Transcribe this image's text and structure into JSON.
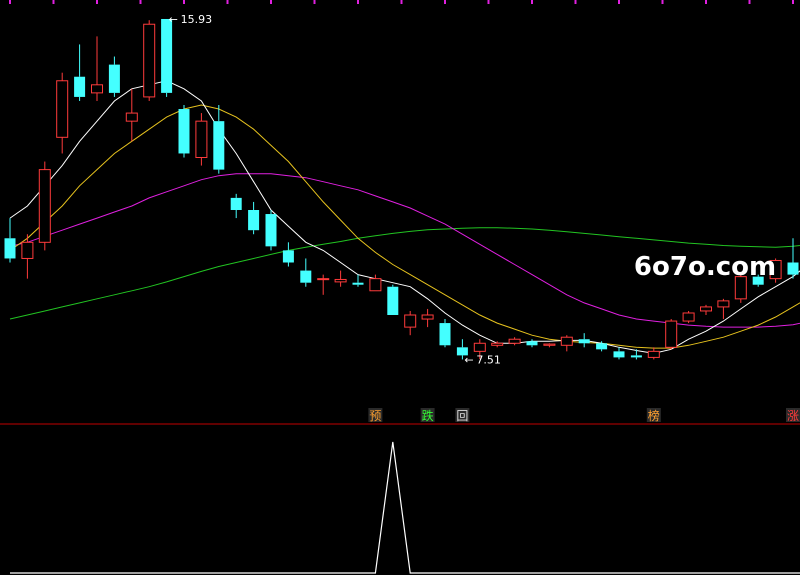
{
  "watermark": "6o7o.com",
  "colors": {
    "background": "#000000",
    "up": "#ff3b3b",
    "down": "#44ffff",
    "ma5": "#ffffff",
    "ma10": "#e6c21e",
    "ma30": "#e020e0",
    "ma60": "#22c422",
    "divider": "#c00000",
    "marker_bg": "#2a2a2a",
    "indicator": "#ffffff",
    "annotation": "#ffffff",
    "top_tick": "#e020e0"
  },
  "chart_data": [
    {
      "type": "candlestick",
      "high_label": "15.93",
      "low_label": "7.51",
      "high_arrow": "←",
      "low_arrow": "←",
      "ylim": [
        6.0,
        16.4
      ],
      "candles": [
        {
          "o": 10.5,
          "h": 11.0,
          "l": 9.9,
          "c": 10.0
        },
        {
          "o": 10.0,
          "h": 10.6,
          "l": 9.5,
          "c": 10.4
        },
        {
          "o": 10.4,
          "h": 12.4,
          "l": 10.2,
          "c": 12.2
        },
        {
          "o": 13.0,
          "h": 14.6,
          "l": 12.6,
          "c": 14.4
        },
        {
          "o": 14.5,
          "h": 15.3,
          "l": 13.9,
          "c": 14.0
        },
        {
          "o": 14.1,
          "h": 15.5,
          "l": 13.9,
          "c": 14.3
        },
        {
          "o": 14.8,
          "h": 15.0,
          "l": 14.0,
          "c": 14.1
        },
        {
          "o": 13.4,
          "h": 14.2,
          "l": 12.9,
          "c": 13.6
        },
        {
          "o": 14.0,
          "h": 15.9,
          "l": 13.9,
          "c": 15.8
        },
        {
          "o": 15.93,
          "h": 15.93,
          "l": 14.0,
          "c": 14.1
        },
        {
          "o": 13.7,
          "h": 13.8,
          "l": 12.5,
          "c": 12.6
        },
        {
          "o": 12.5,
          "h": 13.6,
          "l": 12.3,
          "c": 13.4
        },
        {
          "o": 13.4,
          "h": 13.8,
          "l": 12.1,
          "c": 12.2
        },
        {
          "o": 11.5,
          "h": 11.6,
          "l": 11.0,
          "c": 11.2
        },
        {
          "o": 11.2,
          "h": 11.4,
          "l": 10.6,
          "c": 10.7
        },
        {
          "o": 11.1,
          "h": 11.2,
          "l": 10.2,
          "c": 10.3
        },
        {
          "o": 10.2,
          "h": 10.4,
          "l": 9.8,
          "c": 9.9
        },
        {
          "o": 9.7,
          "h": 10.0,
          "l": 9.3,
          "c": 9.4
        },
        {
          "o": 9.5,
          "h": 9.6,
          "l": 9.1,
          "c": 9.5
        },
        {
          "o": 9.42,
          "h": 9.7,
          "l": 9.3,
          "c": 9.48
        },
        {
          "o": 9.4,
          "h": 9.6,
          "l": 9.3,
          "c": 9.35
        },
        {
          "o": 9.2,
          "h": 9.6,
          "l": 9.2,
          "c": 9.5
        },
        {
          "o": 9.3,
          "h": 9.35,
          "l": 8.6,
          "c": 8.6
        },
        {
          "o": 8.3,
          "h": 8.7,
          "l": 8.1,
          "c": 8.6
        },
        {
          "o": 8.5,
          "h": 8.75,
          "l": 8.3,
          "c": 8.6
        },
        {
          "o": 8.4,
          "h": 8.5,
          "l": 7.8,
          "c": 7.85
        },
        {
          "o": 7.8,
          "h": 8.0,
          "l": 7.5,
          "c": 7.6
        },
        {
          "o": 7.7,
          "h": 8.0,
          "l": 7.51,
          "c": 7.9
        },
        {
          "o": 7.85,
          "h": 7.95,
          "l": 7.8,
          "c": 7.9
        },
        {
          "o": 7.9,
          "h": 8.05,
          "l": 7.85,
          "c": 8.0
        },
        {
          "o": 7.95,
          "h": 8.0,
          "l": 7.8,
          "c": 7.85
        },
        {
          "o": 7.85,
          "h": 7.9,
          "l": 7.8,
          "c": 7.88
        },
        {
          "o": 7.85,
          "h": 8.1,
          "l": 7.7,
          "c": 8.05
        },
        {
          "o": 8.0,
          "h": 8.15,
          "l": 7.8,
          "c": 7.9
        },
        {
          "o": 7.9,
          "h": 7.95,
          "l": 7.7,
          "c": 7.75
        },
        {
          "o": 7.7,
          "h": 7.8,
          "l": 7.5,
          "c": 7.55
        },
        {
          "o": 7.6,
          "h": 7.75,
          "l": 7.5,
          "c": 7.55
        },
        {
          "o": 7.55,
          "h": 7.8,
          "l": 7.5,
          "c": 7.7
        },
        {
          "o": 7.8,
          "h": 8.5,
          "l": 7.75,
          "c": 8.45
        },
        {
          "o": 8.45,
          "h": 8.7,
          "l": 8.4,
          "c": 8.65
        },
        {
          "o": 8.7,
          "h": 8.85,
          "l": 8.6,
          "c": 8.8
        },
        {
          "o": 8.8,
          "h": 9.0,
          "l": 8.5,
          "c": 8.95
        },
        {
          "o": 9.0,
          "h": 9.6,
          "l": 8.9,
          "c": 9.55
        },
        {
          "o": 9.55,
          "h": 9.6,
          "l": 9.3,
          "c": 9.35
        },
        {
          "o": 9.5,
          "h": 10.0,
          "l": 9.4,
          "c": 9.95
        },
        {
          "o": 9.9,
          "h": 10.5,
          "l": 9.5,
          "c": 9.6
        },
        {
          "o": 9.6,
          "h": 10.6,
          "l": 9.55,
          "c": 10.5
        }
      ],
      "ma5": [
        11.0,
        11.3,
        11.8,
        12.3,
        12.9,
        13.4,
        13.9,
        14.2,
        14.3,
        14.4,
        14.2,
        13.9,
        13.2,
        12.6,
        11.9,
        11.2,
        10.8,
        10.4,
        10.2,
        9.9,
        9.6,
        9.5,
        9.4,
        9.3,
        9.0,
        8.65,
        8.35,
        8.1,
        7.9,
        7.9,
        7.95,
        7.95,
        7.97,
        7.97,
        7.9,
        7.8,
        7.72,
        7.65,
        7.75,
        8.0,
        8.2,
        8.45,
        8.75,
        9.05,
        9.3,
        9.55,
        9.9
      ],
      "ma10": [
        10.2,
        10.5,
        10.9,
        11.3,
        11.8,
        12.2,
        12.6,
        12.9,
        13.2,
        13.5,
        13.7,
        13.8,
        13.7,
        13.5,
        13.2,
        12.8,
        12.4,
        11.9,
        11.4,
        10.95,
        10.5,
        10.15,
        9.85,
        9.6,
        9.35,
        9.1,
        8.85,
        8.6,
        8.4,
        8.25,
        8.1,
        8.0,
        7.95,
        7.92,
        7.9,
        7.85,
        7.8,
        7.78,
        7.78,
        7.85,
        7.95,
        8.05,
        8.2,
        8.35,
        8.55,
        8.8,
        9.05
      ],
      "ma30": [
        10.3,
        10.4,
        10.55,
        10.7,
        10.85,
        11.0,
        11.15,
        11.3,
        11.5,
        11.65,
        11.8,
        11.95,
        12.05,
        12.1,
        12.1,
        12.1,
        12.05,
        12.0,
        11.9,
        11.8,
        11.7,
        11.55,
        11.4,
        11.25,
        11.05,
        10.85,
        10.6,
        10.35,
        10.1,
        9.85,
        9.6,
        9.35,
        9.1,
        8.9,
        8.75,
        8.6,
        8.5,
        8.45,
        8.4,
        8.35,
        8.32,
        8.3,
        8.3,
        8.3,
        8.32,
        8.36,
        8.45
      ],
      "ma60": [
        8.5,
        8.6,
        8.7,
        8.8,
        8.9,
        9.0,
        9.1,
        9.2,
        9.3,
        9.42,
        9.55,
        9.68,
        9.8,
        9.9,
        10.0,
        10.1,
        10.2,
        10.28,
        10.35,
        10.42,
        10.5,
        10.56,
        10.62,
        10.67,
        10.71,
        10.73,
        10.75,
        10.76,
        10.76,
        10.75,
        10.73,
        10.7,
        10.66,
        10.62,
        10.58,
        10.54,
        10.5,
        10.46,
        10.42,
        10.38,
        10.35,
        10.32,
        10.3,
        10.29,
        10.28,
        10.3,
        10.35
      ]
    },
    {
      "type": "line",
      "values": [
        0,
        0,
        0,
        0,
        0,
        0,
        0,
        0,
        0,
        0,
        0,
        0,
        0,
        0,
        0,
        0,
        0,
        0,
        0,
        0,
        0,
        0,
        1,
        0,
        0,
        0,
        0,
        0,
        0,
        0,
        0,
        0,
        0,
        0,
        0,
        0,
        0,
        0,
        0,
        0,
        0,
        0,
        0,
        0,
        0,
        0,
        0
      ],
      "ylim": [
        0,
        1
      ]
    }
  ],
  "signals": [
    {
      "index": 21,
      "label": "预",
      "color": "#ffa030"
    },
    {
      "index": 24,
      "label": "跌",
      "color": "#33ff33"
    },
    {
      "index": 26,
      "label": "回",
      "color": "#dddddd"
    },
    {
      "index": 37,
      "label": "榜",
      "color": "#ffa030"
    },
    {
      "index": 45,
      "label": "涨",
      "color": "#ff3b3b"
    }
  ]
}
